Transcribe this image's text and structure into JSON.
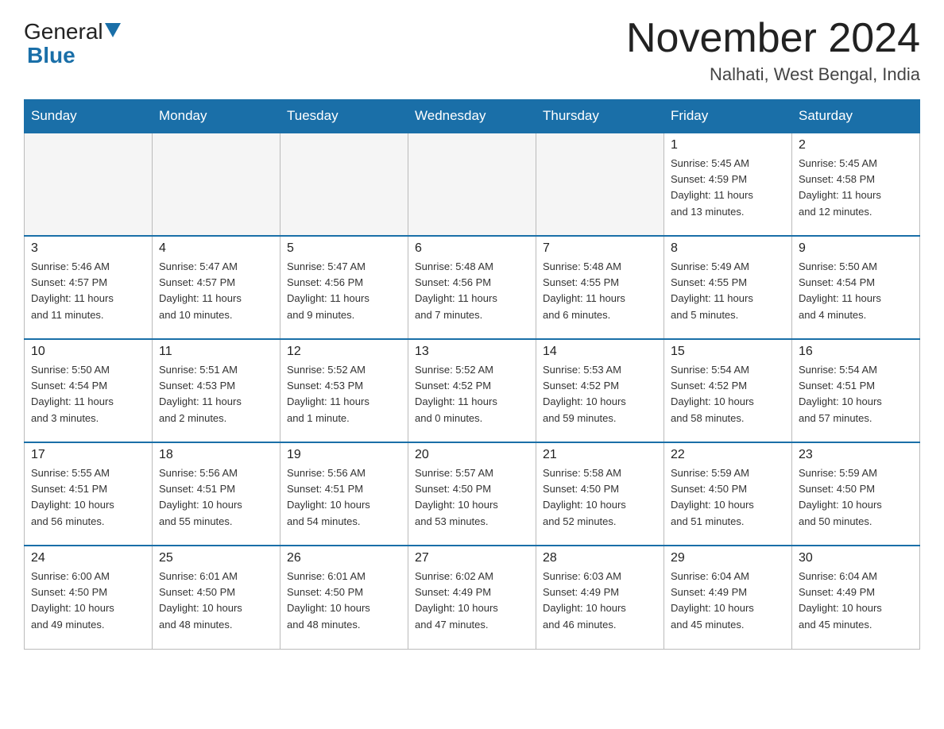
{
  "header": {
    "logo": {
      "general": "General",
      "blue": "Blue"
    },
    "title": "November 2024",
    "location": "Nalhati, West Bengal, India"
  },
  "days_of_week": [
    "Sunday",
    "Monday",
    "Tuesday",
    "Wednesday",
    "Thursday",
    "Friday",
    "Saturday"
  ],
  "weeks": [
    [
      {
        "day": "",
        "info": "",
        "empty": true
      },
      {
        "day": "",
        "info": "",
        "empty": true
      },
      {
        "day": "",
        "info": "",
        "empty": true
      },
      {
        "day": "",
        "info": "",
        "empty": true
      },
      {
        "day": "",
        "info": "",
        "empty": true
      },
      {
        "day": "1",
        "info": "Sunrise: 5:45 AM\nSunset: 4:59 PM\nDaylight: 11 hours\nand 13 minutes."
      },
      {
        "day": "2",
        "info": "Sunrise: 5:45 AM\nSunset: 4:58 PM\nDaylight: 11 hours\nand 12 minutes."
      }
    ],
    [
      {
        "day": "3",
        "info": "Sunrise: 5:46 AM\nSunset: 4:57 PM\nDaylight: 11 hours\nand 11 minutes."
      },
      {
        "day": "4",
        "info": "Sunrise: 5:47 AM\nSunset: 4:57 PM\nDaylight: 11 hours\nand 10 minutes."
      },
      {
        "day": "5",
        "info": "Sunrise: 5:47 AM\nSunset: 4:56 PM\nDaylight: 11 hours\nand 9 minutes."
      },
      {
        "day": "6",
        "info": "Sunrise: 5:48 AM\nSunset: 4:56 PM\nDaylight: 11 hours\nand 7 minutes."
      },
      {
        "day": "7",
        "info": "Sunrise: 5:48 AM\nSunset: 4:55 PM\nDaylight: 11 hours\nand 6 minutes."
      },
      {
        "day": "8",
        "info": "Sunrise: 5:49 AM\nSunset: 4:55 PM\nDaylight: 11 hours\nand 5 minutes."
      },
      {
        "day": "9",
        "info": "Sunrise: 5:50 AM\nSunset: 4:54 PM\nDaylight: 11 hours\nand 4 minutes."
      }
    ],
    [
      {
        "day": "10",
        "info": "Sunrise: 5:50 AM\nSunset: 4:54 PM\nDaylight: 11 hours\nand 3 minutes."
      },
      {
        "day": "11",
        "info": "Sunrise: 5:51 AM\nSunset: 4:53 PM\nDaylight: 11 hours\nand 2 minutes."
      },
      {
        "day": "12",
        "info": "Sunrise: 5:52 AM\nSunset: 4:53 PM\nDaylight: 11 hours\nand 1 minute."
      },
      {
        "day": "13",
        "info": "Sunrise: 5:52 AM\nSunset: 4:52 PM\nDaylight: 11 hours\nand 0 minutes."
      },
      {
        "day": "14",
        "info": "Sunrise: 5:53 AM\nSunset: 4:52 PM\nDaylight: 10 hours\nand 59 minutes."
      },
      {
        "day": "15",
        "info": "Sunrise: 5:54 AM\nSunset: 4:52 PM\nDaylight: 10 hours\nand 58 minutes."
      },
      {
        "day": "16",
        "info": "Sunrise: 5:54 AM\nSunset: 4:51 PM\nDaylight: 10 hours\nand 57 minutes."
      }
    ],
    [
      {
        "day": "17",
        "info": "Sunrise: 5:55 AM\nSunset: 4:51 PM\nDaylight: 10 hours\nand 56 minutes."
      },
      {
        "day": "18",
        "info": "Sunrise: 5:56 AM\nSunset: 4:51 PM\nDaylight: 10 hours\nand 55 minutes."
      },
      {
        "day": "19",
        "info": "Sunrise: 5:56 AM\nSunset: 4:51 PM\nDaylight: 10 hours\nand 54 minutes."
      },
      {
        "day": "20",
        "info": "Sunrise: 5:57 AM\nSunset: 4:50 PM\nDaylight: 10 hours\nand 53 minutes."
      },
      {
        "day": "21",
        "info": "Sunrise: 5:58 AM\nSunset: 4:50 PM\nDaylight: 10 hours\nand 52 minutes."
      },
      {
        "day": "22",
        "info": "Sunrise: 5:59 AM\nSunset: 4:50 PM\nDaylight: 10 hours\nand 51 minutes."
      },
      {
        "day": "23",
        "info": "Sunrise: 5:59 AM\nSunset: 4:50 PM\nDaylight: 10 hours\nand 50 minutes."
      }
    ],
    [
      {
        "day": "24",
        "info": "Sunrise: 6:00 AM\nSunset: 4:50 PM\nDaylight: 10 hours\nand 49 minutes."
      },
      {
        "day": "25",
        "info": "Sunrise: 6:01 AM\nSunset: 4:50 PM\nDaylight: 10 hours\nand 48 minutes."
      },
      {
        "day": "26",
        "info": "Sunrise: 6:01 AM\nSunset: 4:50 PM\nDaylight: 10 hours\nand 48 minutes."
      },
      {
        "day": "27",
        "info": "Sunrise: 6:02 AM\nSunset: 4:49 PM\nDaylight: 10 hours\nand 47 minutes."
      },
      {
        "day": "28",
        "info": "Sunrise: 6:03 AM\nSunset: 4:49 PM\nDaylight: 10 hours\nand 46 minutes."
      },
      {
        "day": "29",
        "info": "Sunrise: 6:04 AM\nSunset: 4:49 PM\nDaylight: 10 hours\nand 45 minutes."
      },
      {
        "day": "30",
        "info": "Sunrise: 6:04 AM\nSunset: 4:49 PM\nDaylight: 10 hours\nand 45 minutes."
      }
    ]
  ]
}
